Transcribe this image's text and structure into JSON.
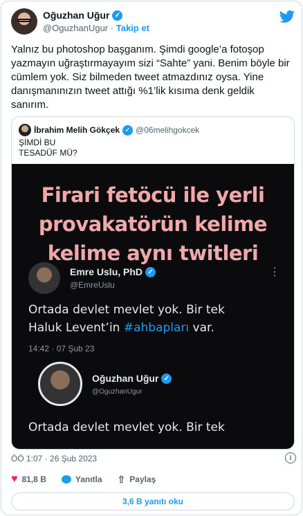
{
  "author": {
    "name": "Oğuzhan Uğur",
    "handle": "@OguzhanUgur",
    "separator": "·",
    "follow_label": "Takip et"
  },
  "tweet": {
    "text": "Yalnız bu photoshop başganım. Şimdi google’a fotoşop yazmayın uğraştırmayayım sizi “Sahte” yani. Benim böyle bir cümlem yok. Siz bilmeden tweet atmazdınız oysa. Yine danışmanınızın tweet attığı %1’lik kısıma denk geldik sanırım."
  },
  "quoted": {
    "name": "İbrahim Melih Gökçek",
    "handle": "@06melihgokcek",
    "line1": "ŞİMDİ BU",
    "line2": "TESADÜF MÜ?"
  },
  "media": {
    "title_line1": "Firari fetöcü ile yerli",
    "title_line2": "provakatörün kelime",
    "title_line3": "kelime  aynı twitleri",
    "tweet1": {
      "name": "Emre Uslu, PhD",
      "handle": "@EmreUslu",
      "text_line1": "Ortada devlet mevlet yok. Bir tek",
      "text_line2_pre": "Haluk Levent’in ",
      "hashtag": "#ahbapları",
      "text_line2_post": " var.",
      "time": "14:42 · 07 Şub 23"
    },
    "tweet2": {
      "name": "Oğuzhan Uğur",
      "handle": "@OguzhanUgur",
      "text_line1": "Ortada devlet mevlet yok. Bir tek"
    }
  },
  "meta": {
    "timestamp": "ÖÖ 1:07 · 26 Şub 2023"
  },
  "actions": {
    "likes": "81,8 B",
    "reply_label": "Yanıtla",
    "share_label": "Paylaş"
  },
  "replies_button": "3,6 B yanıtı oku",
  "colors": {
    "accent": "#1d9bf0",
    "like": "#f91880",
    "title_pink": "#f1a8a8"
  },
  "icons": [
    "verified-icon",
    "twitter-bird-icon",
    "heart-icon",
    "reply-icon",
    "share-icon",
    "info-icon",
    "more-icon"
  ]
}
